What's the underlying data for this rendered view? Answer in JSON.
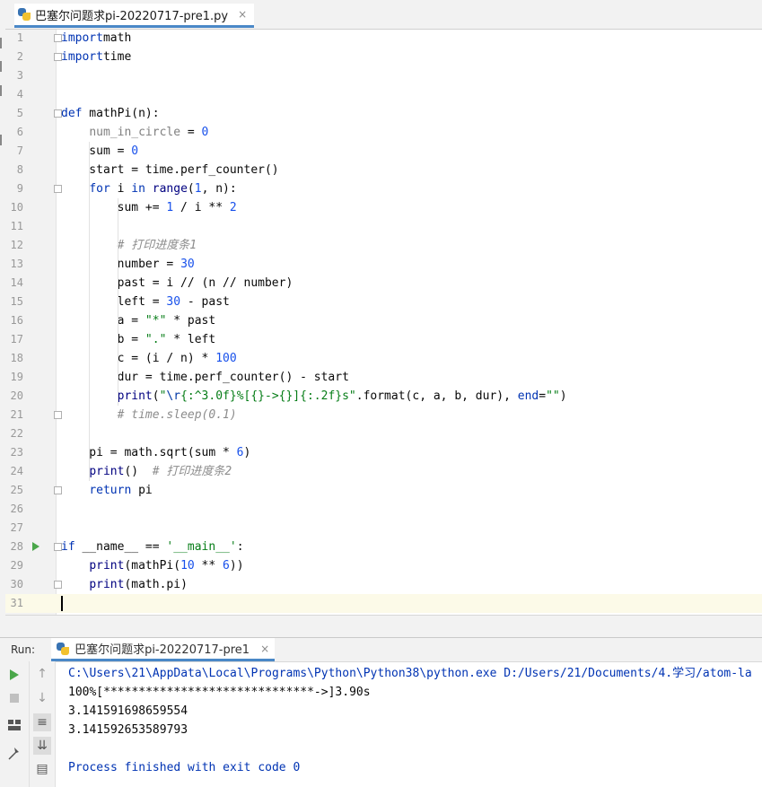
{
  "file_tab": {
    "name": "巴塞尔问题求pi-20220717-pre1.py",
    "close": "×"
  },
  "code_lines": [
    {
      "n": "1",
      "t": [
        [
          "kw",
          "import"
        ],
        [
          "",
          "math"
        ]
      ]
    },
    {
      "n": "2",
      "t": [
        [
          "kw",
          "import"
        ],
        [
          "",
          "time"
        ]
      ]
    },
    {
      "n": "3",
      "t": []
    },
    {
      "n": "4",
      "t": []
    },
    {
      "n": "5",
      "t": [
        [
          "kw",
          "def"
        ],
        [
          "",
          " mathPi(n):"
        ]
      ]
    },
    {
      "n": "6",
      "t": [
        [
          "",
          "    "
        ],
        [
          "unused",
          "num_in_circle"
        ],
        [
          "",
          " = "
        ],
        [
          "num",
          "0"
        ]
      ]
    },
    {
      "n": "7",
      "t": [
        [
          "",
          "    sum = "
        ],
        [
          "num",
          "0"
        ]
      ]
    },
    {
      "n": "8",
      "t": [
        [
          "",
          "    start = time.perf_counter()"
        ]
      ]
    },
    {
      "n": "9",
      "t": [
        [
          "",
          "    "
        ],
        [
          "kw",
          "for"
        ],
        [
          "",
          " i "
        ],
        [
          "kw",
          "in"
        ],
        [
          "",
          " "
        ],
        [
          "bi",
          "range"
        ],
        [
          "",
          "("
        ],
        [
          "num",
          "1"
        ],
        [
          "",
          ", n):"
        ]
      ]
    },
    {
      "n": "10",
      "t": [
        [
          "",
          "        sum += "
        ],
        [
          "num",
          "1"
        ],
        [
          "",
          " / i ** "
        ],
        [
          "num",
          "2"
        ]
      ]
    },
    {
      "n": "11",
      "t": []
    },
    {
      "n": "12",
      "t": [
        [
          "",
          "        "
        ],
        [
          "cm",
          "# 打印进度条1"
        ]
      ]
    },
    {
      "n": "13",
      "t": [
        [
          "",
          "        number = "
        ],
        [
          "num",
          "30"
        ]
      ]
    },
    {
      "n": "14",
      "t": [
        [
          "",
          "        past = i // (n // number)"
        ]
      ]
    },
    {
      "n": "15",
      "t": [
        [
          "",
          "        left = "
        ],
        [
          "num",
          "30"
        ],
        [
          "",
          " - past"
        ]
      ]
    },
    {
      "n": "16",
      "t": [
        [
          "",
          "        a = "
        ],
        [
          "str",
          "\"*\""
        ],
        [
          "",
          " * past"
        ]
      ]
    },
    {
      "n": "17",
      "t": [
        [
          "",
          "        b = "
        ],
        [
          "str",
          "\".\""
        ],
        [
          "",
          " * left"
        ]
      ]
    },
    {
      "n": "18",
      "t": [
        [
          "",
          "        c = (i / n) * "
        ],
        [
          "num",
          "100"
        ]
      ]
    },
    {
      "n": "19",
      "t": [
        [
          "",
          "        dur = time.perf_counter() - start"
        ]
      ]
    },
    {
      "n": "20",
      "t": [
        [
          "",
          "        "
        ],
        [
          "bi",
          "print"
        ],
        [
          "",
          "("
        ],
        [
          "str",
          "\""
        ],
        [
          "esc",
          "\\r"
        ],
        [
          "str",
          "{:^3.0f}%[{}->{}]{:.2f}s\""
        ],
        [
          "",
          ".format(c, a, b, dur), "
        ],
        [
          "kw",
          "end"
        ],
        [
          "",
          "="
        ],
        [
          "str",
          "\"\""
        ],
        [
          "",
          ")"
        ]
      ]
    },
    {
      "n": "21",
      "t": [
        [
          "",
          "        "
        ],
        [
          "cm",
          "# time.sleep(0.1)"
        ]
      ]
    },
    {
      "n": "22",
      "t": []
    },
    {
      "n": "23",
      "t": [
        [
          "",
          "    pi = math.sqrt(sum * "
        ],
        [
          "num",
          "6"
        ],
        [
          "",
          ")"
        ]
      ]
    },
    {
      "n": "24",
      "t": [
        [
          "",
          "    "
        ],
        [
          "bi",
          "print"
        ],
        [
          "",
          "()  "
        ],
        [
          "cm",
          "# 打印进度条2"
        ]
      ]
    },
    {
      "n": "25",
      "t": [
        [
          "",
          "    "
        ],
        [
          "kw",
          "return"
        ],
        [
          "",
          " pi"
        ]
      ]
    },
    {
      "n": "26",
      "t": []
    },
    {
      "n": "27",
      "t": []
    },
    {
      "n": "28",
      "t": [
        [
          "kw",
          "if"
        ],
        [
          "",
          " __name__ == "
        ],
        [
          "str",
          "'__main__'"
        ],
        [
          "",
          ":"
        ]
      ]
    },
    {
      "n": "29",
      "t": [
        [
          "",
          "    "
        ],
        [
          "bi",
          "print"
        ],
        [
          "",
          "(mathPi("
        ],
        [
          "num",
          "10"
        ],
        [
          "",
          " ** "
        ],
        [
          "num",
          "6"
        ],
        [
          "",
          "))"
        ]
      ]
    },
    {
      "n": "30",
      "t": [
        [
          "",
          "    "
        ],
        [
          "bi",
          "print"
        ],
        [
          "",
          "(math.pi)"
        ]
      ]
    },
    {
      "n": "31",
      "t": []
    }
  ],
  "run_panel": {
    "label": "Run:",
    "tab_name": "巴塞尔问题求pi-20220717-pre1",
    "tab_close": "×",
    "console_lines": [
      "C:\\Users\\21\\AppData\\Local\\Programs\\Python\\Python38\\python.exe D:/Users/21/Documents/4.学习/atom-la",
      "100%[******************************->]3.90s",
      "3.141591698659554",
      "3.141592653589793",
      "",
      "Process finished with exit code 0"
    ]
  },
  "colors": {
    "keyword": "#0033b3",
    "number": "#1750eb",
    "string": "#067d17",
    "comment": "#8c8c8c",
    "accent": "#4a88c7"
  }
}
